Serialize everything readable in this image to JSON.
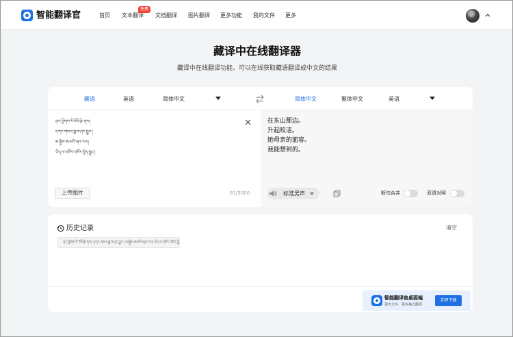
{
  "app": {
    "name": "智能翻译官"
  },
  "nav": {
    "items": [
      {
        "label": "首页"
      },
      {
        "label": "文本翻译",
        "badge": "免费"
      },
      {
        "label": "文档翻译"
      },
      {
        "label": "图片翻译"
      },
      {
        "label": "更多功能"
      },
      {
        "label": "我的文件"
      },
      {
        "label": "更多"
      }
    ]
  },
  "hero": {
    "title": "藏译中在线翻译器",
    "subtitle": "藏译中在线翻译功能，可以在线获取藏语翻译成中文的结果"
  },
  "translator": {
    "source_langs": [
      "藏语",
      "英语",
      "简体中文"
    ],
    "target_langs": [
      "简体中文",
      "繁体中文",
      "英语"
    ],
    "source_lines": [
      "ཤར་ཕྱོགས་རི་བོའི་རྩེ་ནས།",
      "དཀར་གསལ་ཟླ་བ་ཤར་བྱུང་།",
      "མ་སྐྱེས་ཨ་མའི་ཞལ་རས།",
      "ཡིད་ལ་འཁོར་འཁོར་བྱེད་བྱུང་།"
    ],
    "upload_label": "上传图片",
    "char_count": "81/5000",
    "output_lines": [
      "在东山那边。",
      "升起皎洁。",
      "她母亲的面容。",
      "我能想到的。"
    ],
    "voice_label": "标准男声",
    "merge_label": "断句合并",
    "bilingual_label": "双语对照"
  },
  "history": {
    "title": "历史记录",
    "clear_label": "清空",
    "items": [
      "ཤར་ཕྱོགས་རི་བོའི་རྩེ་ནས། དཀར་གསལ་ཟླ་བ་ཤར་བྱུང་། མ་སྐྱེས་ཨ་མའི་ཞལ་རས། ཡིད་ལ་འཁོར་འཁོར་བྱེད་བྱུང་།"
    ]
  },
  "promo": {
    "title": "智能翻译官桌面端",
    "desc": "更大文件、更多格式翻译",
    "button": "立即下载"
  },
  "colors": {
    "accent": "#1f6fe5",
    "badge": "#f2463c",
    "page_bg": "#f3f4f6"
  }
}
